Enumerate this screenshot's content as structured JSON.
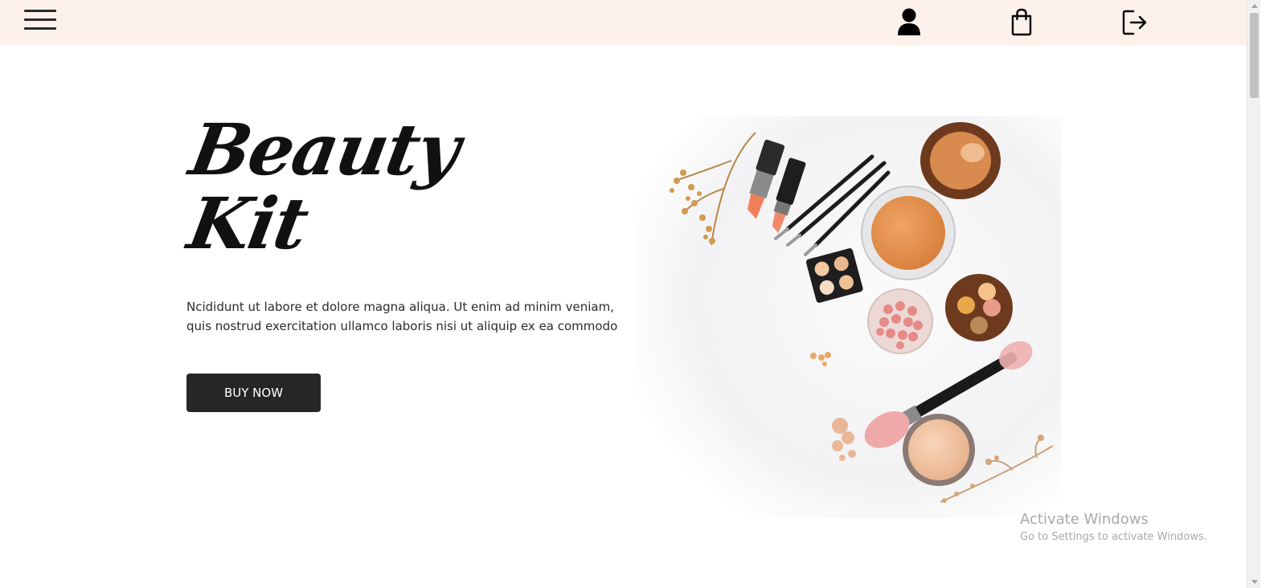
{
  "hero": {
    "title_line1": "Beauty",
    "title_line2": "Kit",
    "description_line1": "Ncididunt ut labore et dolore magna aliqua. Ut enim ad minim veniam,",
    "description_line2": "quis nostrud exercitation ullamco laboris nisi ut aliquip ex ea commodo",
    "button_label": "BUY NOW"
  },
  "nav": {
    "icons": [
      "hamburger-menu-icon",
      "user-icon",
      "shopping-bag-icon",
      "logout-icon"
    ]
  },
  "watermark": {
    "title": "Activate Windows",
    "subtitle": "Go to Settings to activate Windows."
  },
  "colors": {
    "topbar_bg": "#fdf2eb",
    "button_bg": "#262626",
    "button_text": "#ffffff",
    "page_bg": "#ffffff"
  }
}
